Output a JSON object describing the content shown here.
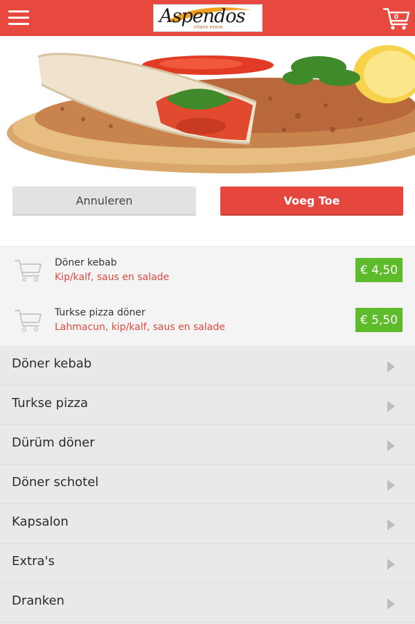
{
  "header": {
    "logo_text": "Aspendos",
    "logo_subtext": "DÖNER KEBAB",
    "cart_count": "0",
    "brand_color": "#e8493e"
  },
  "actions": {
    "cancel_label": "Annuleren",
    "add_label": "Voeg Toe"
  },
  "cart_items": [
    {
      "name": "Döner kebab",
      "description": "Kip/kalf, saus en salade",
      "price": "€ 4,50"
    },
    {
      "name": "Turkse pizza döner",
      "description": "Lahmacun, kip/kalf, saus en salade",
      "price": "€ 5,50"
    }
  ],
  "categories": [
    {
      "label": "Döner kebab"
    },
    {
      "label": "Turkse pizza"
    },
    {
      "label": "Dürüm döner"
    },
    {
      "label": "Döner schotel"
    },
    {
      "label": "Kapsalon"
    },
    {
      "label": "Extra's"
    },
    {
      "label": "Dranken"
    }
  ],
  "colors": {
    "price_badge": "#5dbb2c",
    "description_text": "#d84a3e",
    "primary_button": "#e5463e"
  }
}
